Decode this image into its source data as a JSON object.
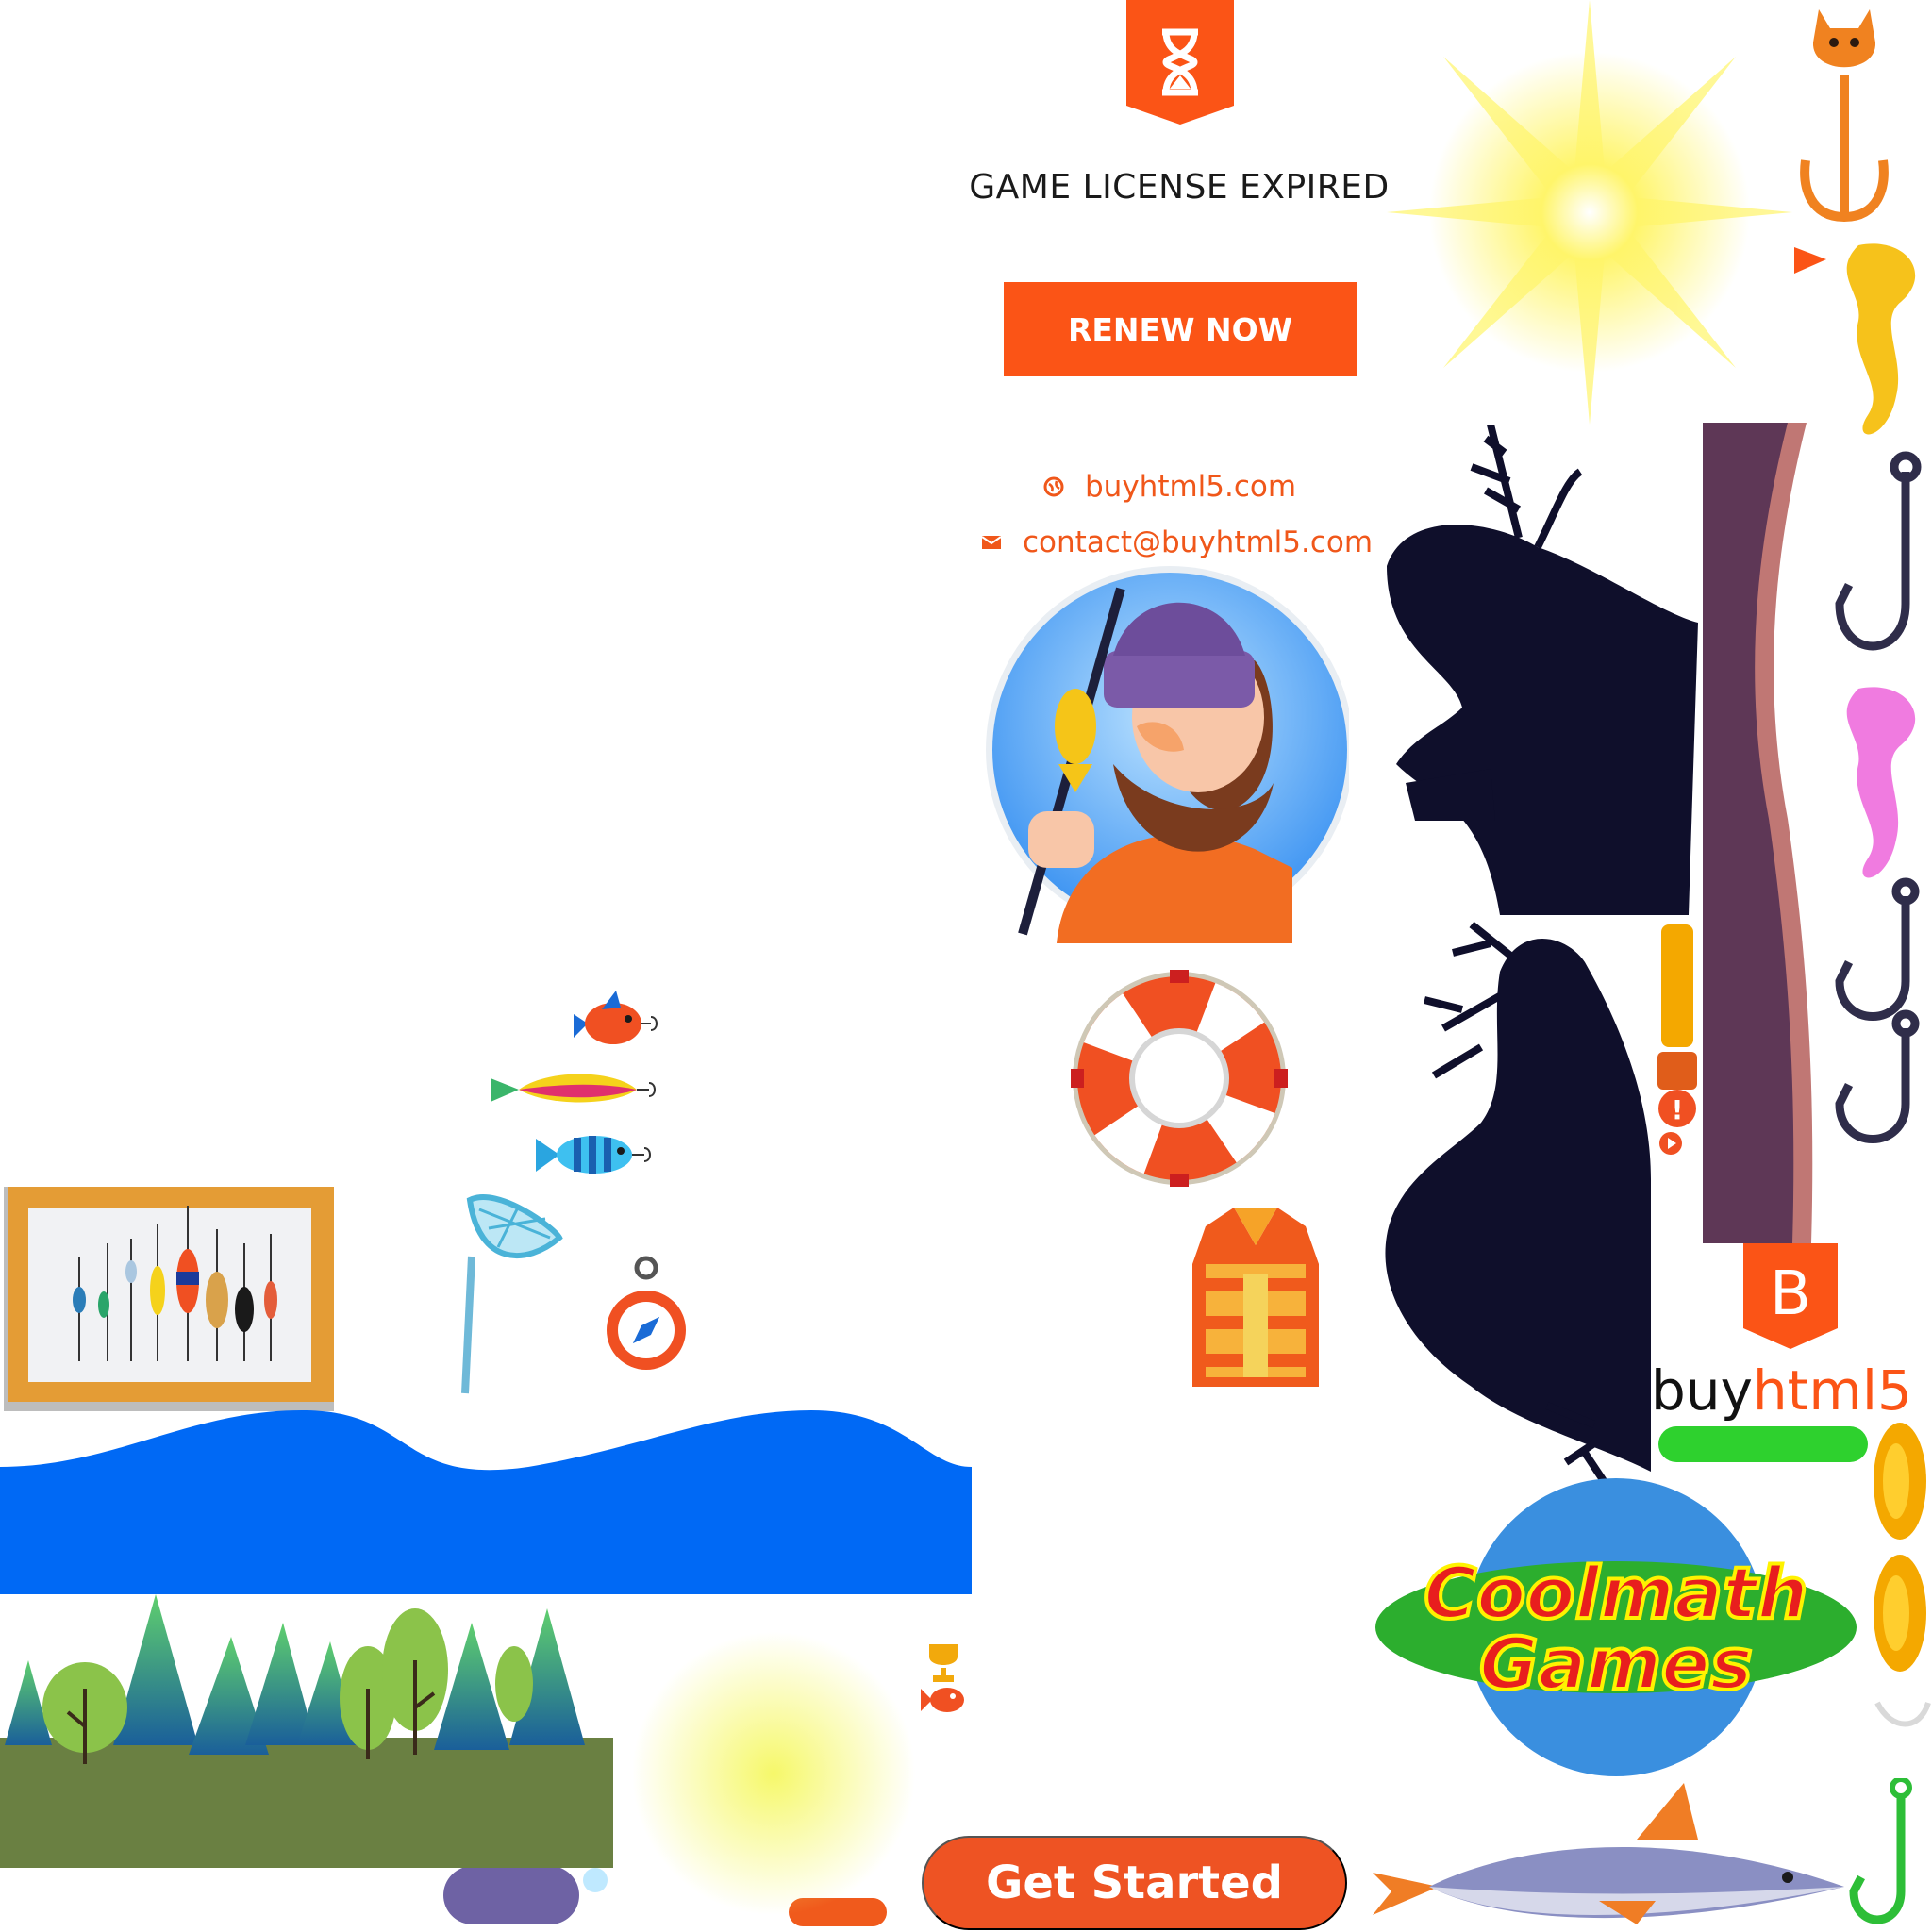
{
  "license": {
    "title": "GAME LICENSE EXPIRED",
    "renew_label": "RENEW NOW",
    "website": "buyhtml5.com",
    "email": "contact@buyhtml5.com",
    "badge_icon": "hourglass-icon"
  },
  "start": {
    "get_started_label": "Get Started"
  },
  "branding": {
    "brand_prefix": "buy",
    "brand_suffix": "html5",
    "brand_letter": "B",
    "coolmath_line1": "Coolmath",
    "coolmath_line2": "Games"
  },
  "colors": {
    "accent": "#fb5416",
    "water": "#0069f5",
    "grass": "#6a8042",
    "silhouette": "#0f0f2b"
  }
}
